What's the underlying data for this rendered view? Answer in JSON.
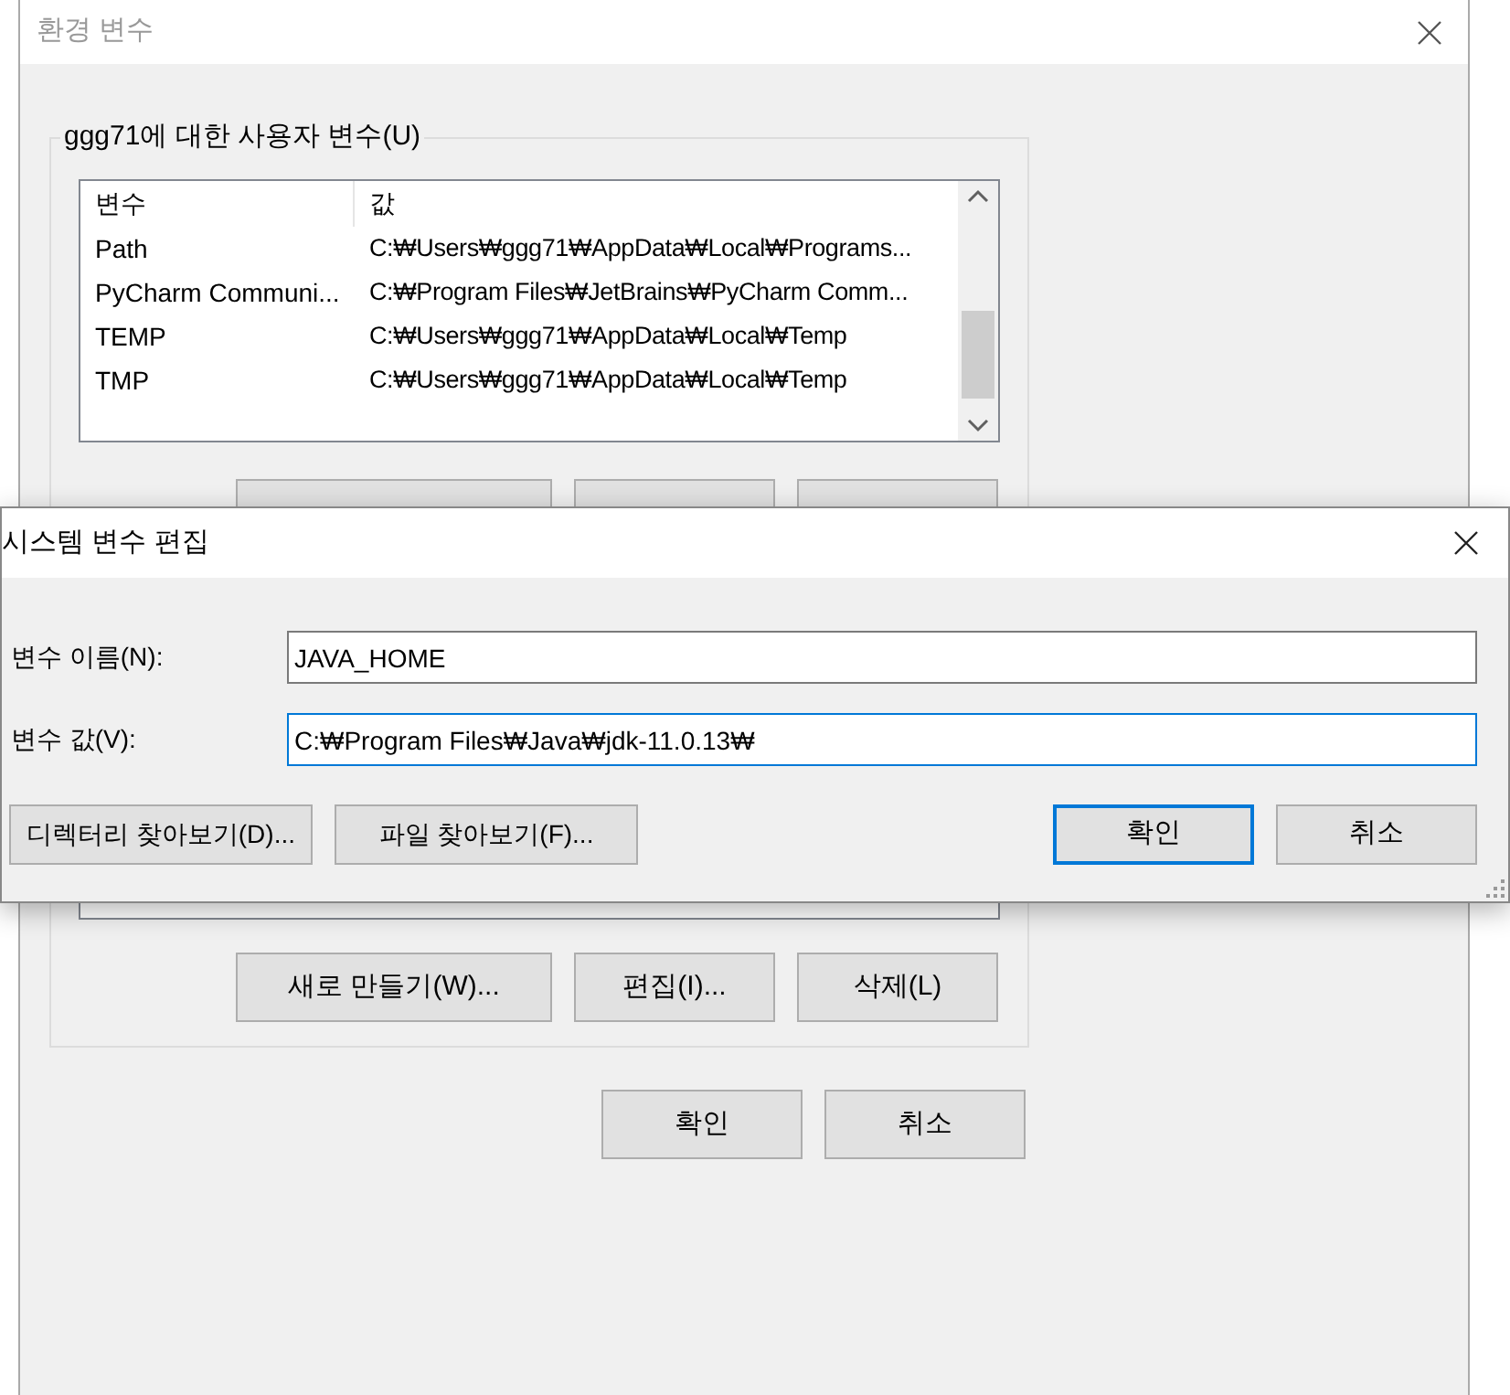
{
  "background_window": {
    "title": "환경 변수",
    "active": false,
    "user_variables": {
      "label": "ggg71에 대한 사용자 변수(U)",
      "columns": [
        "변수",
        "값"
      ],
      "rows": [
        {
          "name": "Path",
          "value": "C:₩Users₩ggg71₩AppData₩Local₩Programs..."
        },
        {
          "name": "PyCharm Communi...",
          "value": "C:₩Program Files₩JetBrains₩PyCharm Comm..."
        },
        {
          "name": "TEMP",
          "value": "C:₩Users₩ggg71₩AppData₩Local₩Temp"
        },
        {
          "name": "TMP",
          "value": "C:₩Users₩ggg71₩AppData₩Local₩Temp"
        }
      ]
    },
    "system_buttons": [
      "새로 만들기(W)...",
      "편집(I)...",
      "삭제(L)"
    ],
    "buttons": [
      "확인",
      "취소"
    ]
  },
  "dialog": {
    "title": "시스템 변수 편집",
    "active": true,
    "fields": [
      {
        "label": "변수 이름(N):",
        "value": "JAVA_HOME",
        "focused": false
      },
      {
        "label": "변수 값(V):",
        "value": "C:₩Program Files₩Java₩jdk-11.0.13₩",
        "focused": true
      }
    ],
    "left_buttons": [
      "디렉터리 찾아보기(D)...",
      "파일 찾아보기(F)..."
    ],
    "right_buttons": [
      {
        "label": "확인",
        "default": true
      },
      {
        "label": "취소",
        "default": false
      }
    ]
  }
}
